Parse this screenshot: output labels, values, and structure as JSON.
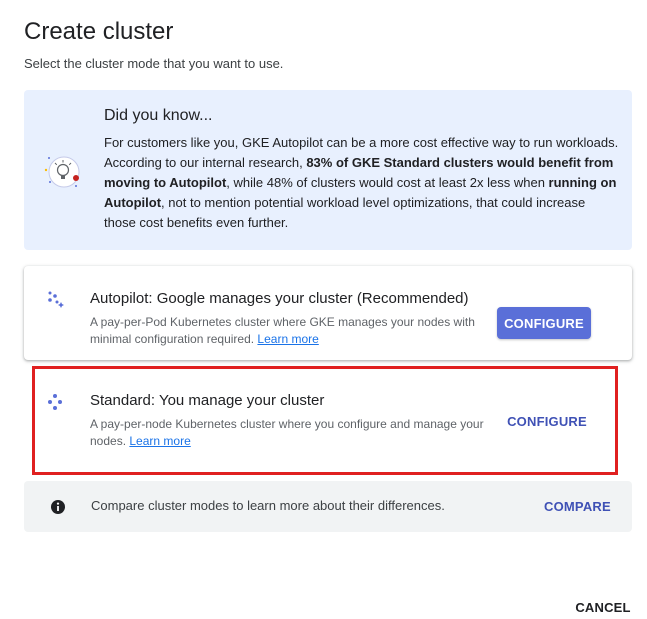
{
  "header": {
    "title": "Create cluster",
    "subtitle": "Select the cluster mode that you want to use."
  },
  "info": {
    "heading": "Did you know...",
    "body_1": "For customers like you, GKE Autopilot can be a more cost effective way to run workloads. According to our internal research, ",
    "body_bold_1": "83% of GKE Standard clusters would benefit from moving to Autopilot",
    "body_2": ", while 48% of clusters would cost at least 2x less when ",
    "body_bold_2": "running on Autopilot",
    "body_3": ", not to mention potential workload level optimizations, that could increase those cost benefits even further.",
    "illustration_icon": "lightbulb-illustration-icon"
  },
  "modes": {
    "autopilot": {
      "title": "Autopilot: Google manages your cluster (Recommended)",
      "description": "A pay-per-Pod Kubernetes cluster where GKE manages your nodes with minimal configuration required. ",
      "learn_more": "Learn more",
      "button_label": "CONFIGURE",
      "icon": "autopilot-sparkle-icon"
    },
    "standard": {
      "title": "Standard: You manage your cluster",
      "description": "A pay-per-node Kubernetes cluster where you configure and manage your nodes. ",
      "learn_more": "Learn more",
      "button_label": "CONFIGURE",
      "icon": "standard-nodes-icon"
    }
  },
  "compare": {
    "text": "Compare cluster modes to learn more about their differences.",
    "button_label": "COMPARE",
    "icon": "info-icon"
  },
  "footer": {
    "cancel_label": "CANCEL"
  },
  "colors": {
    "accent": "#5a6fd8",
    "link": "#1a73e8",
    "info_bg": "#e8f0fe",
    "highlight": "#e02020",
    "compare_bg": "#f1f3f4"
  }
}
